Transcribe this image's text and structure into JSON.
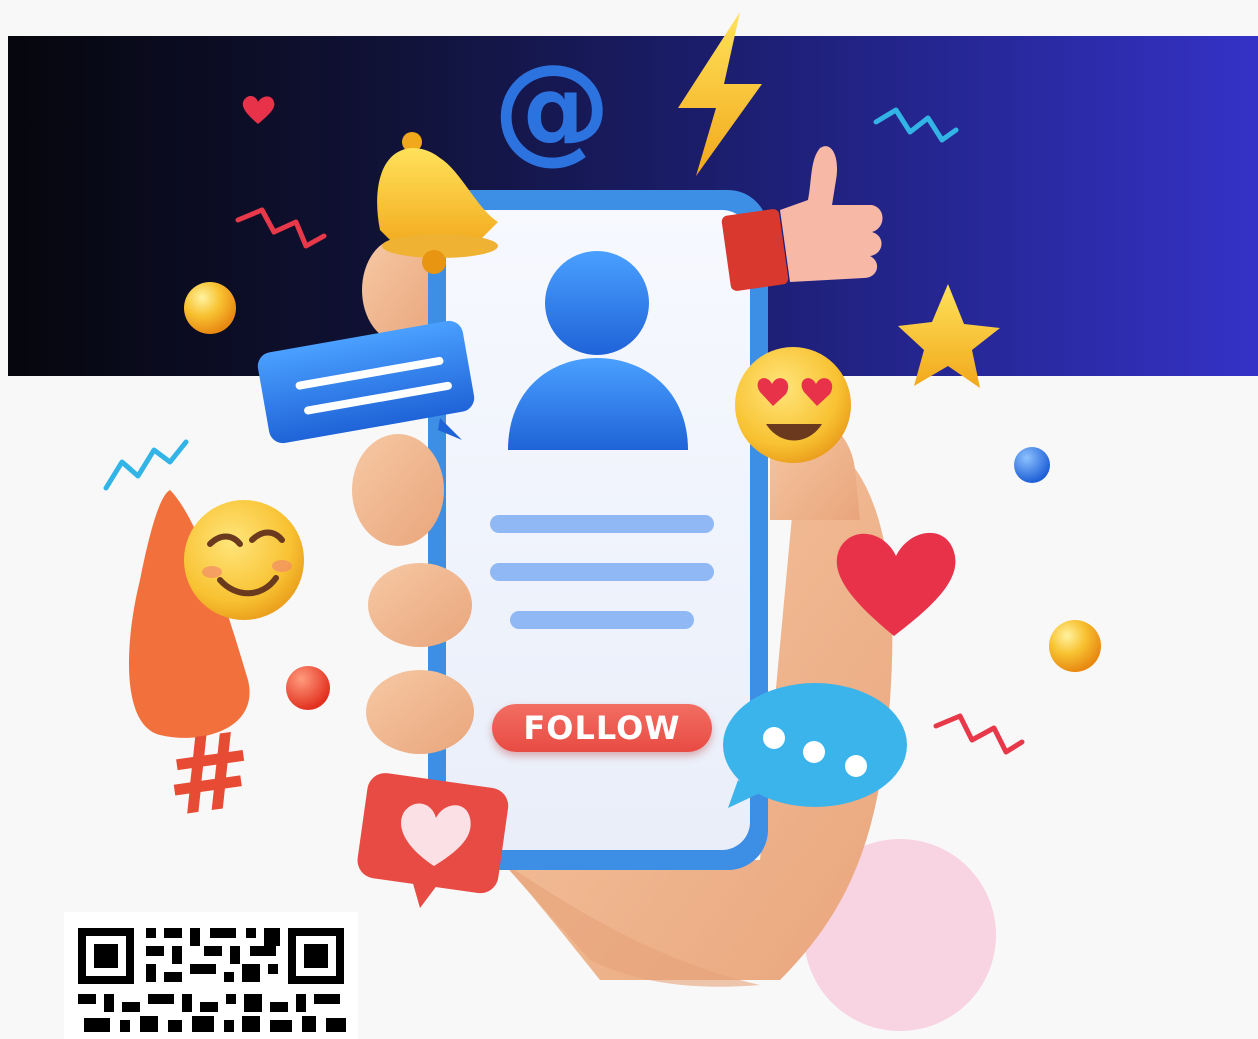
{
  "profile_card": {
    "follow_label": "FOLLOW"
  },
  "symbols": {
    "at_sign": "@",
    "hashtag": "#"
  },
  "icons": [
    "bell-icon",
    "at-sign-icon",
    "lightning-icon",
    "thumbs-up-icon",
    "star-icon",
    "heart-icon",
    "chat-bubble-icon",
    "typing-bubble-icon",
    "heart-badge-icon",
    "hashtag-icon",
    "smiling-emoji-icon",
    "heart-eyes-emoji-icon",
    "user-avatar-icon",
    "qr-code-icon"
  ],
  "colors": {
    "banner_start": "#06060d",
    "banner_end": "#3432c6",
    "background": "#f8f8f8",
    "phone_frame": "#3d8fe6",
    "follow_button": "#e84b43",
    "accent_blue": "#2d73e0",
    "heart_red": "#e8324a",
    "emoji_yellow": "#f8c232"
  }
}
